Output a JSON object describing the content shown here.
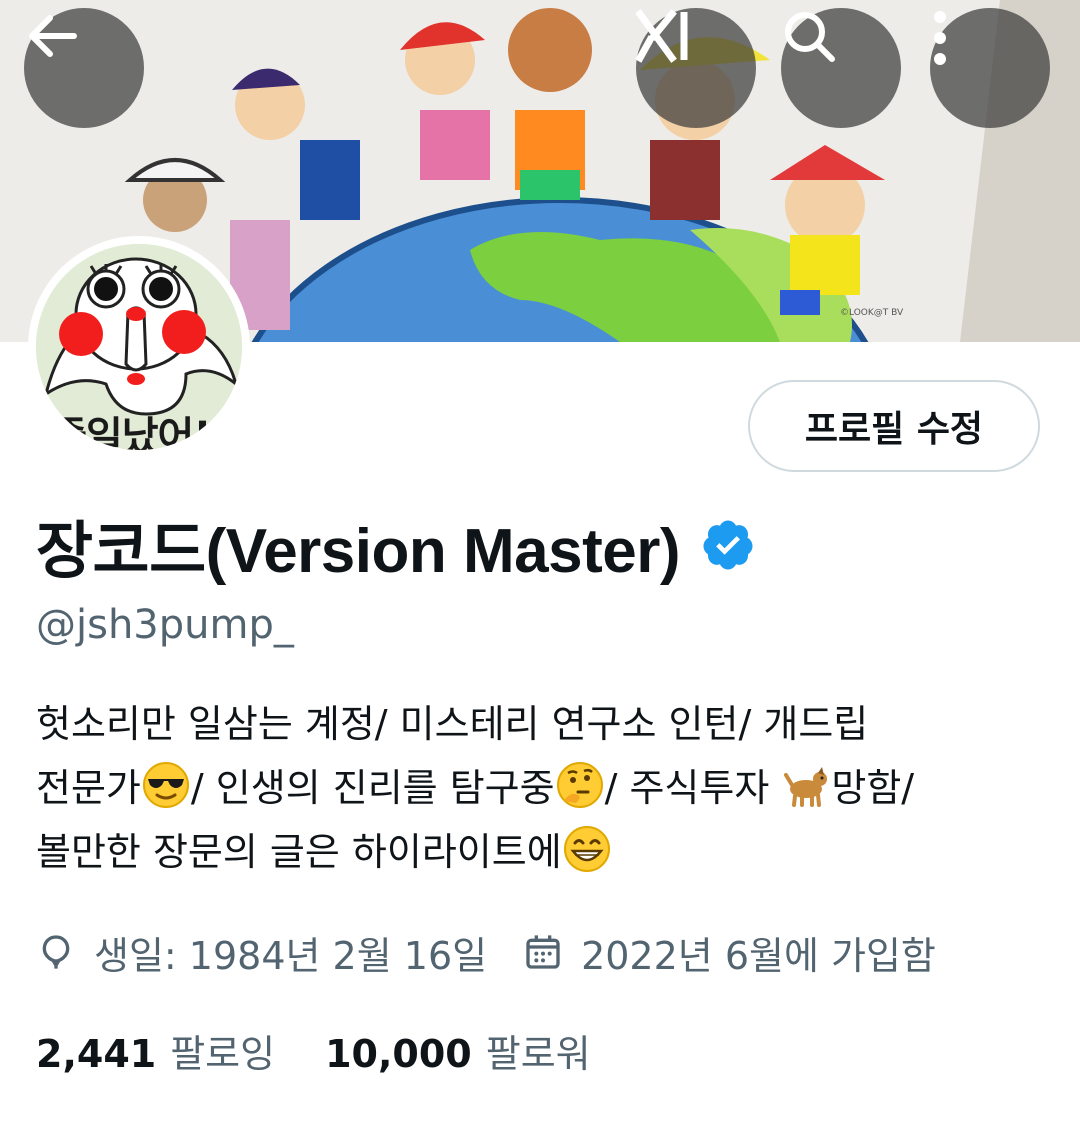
{
  "header": {
    "back_icon": "arrow-left-icon",
    "grok_icon": "grok-icon",
    "search_icon": "search-icon",
    "more_icon": "more-vertical-icon"
  },
  "banner": {
    "signature": "©LOOK@T BV"
  },
  "avatar": {
    "text": "좋일났어!!"
  },
  "profile": {
    "edit_button_label": "프로필 수정",
    "display_name": "장코드(Version Master)",
    "verified": true,
    "verified_color": "#1d9bf0",
    "handle": "@jsh3pump_"
  },
  "bio": {
    "line1": "헛소리만 일삼는 계정/ 미스테리 연구소 인턴/ 개드립",
    "line2_a": "전문가",
    "line2_b": "/ 인생의 진리를 탐구중",
    "line2_c": "/ 주식투자 ",
    "line2_d": "망함/",
    "line3_a": "볼만한 장문의 글은 하이라이트에",
    "emojis": [
      "smiling-face-with-sunglasses",
      "thinking-face",
      "dog",
      "grinning-face-with-smiling-eyes"
    ]
  },
  "meta": {
    "birthday": "생일: 1984년 2월 16일",
    "joined": "2022년 6월에 가입함"
  },
  "stats": {
    "following_count": "2,441",
    "following_label": "팔로잉",
    "followers_count": "10,000",
    "followers_label": "팔로워"
  },
  "colors": {
    "primary_text": "#0f1419",
    "secondary_text": "#536471",
    "border": "#cfd9de",
    "accent": "#1d9bf0"
  }
}
